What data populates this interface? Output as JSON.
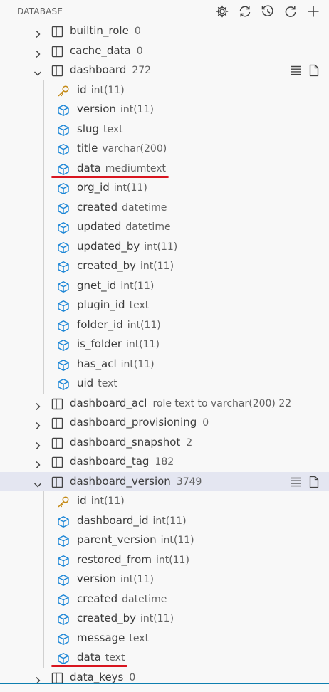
{
  "header": {
    "title": "DATABASE"
  },
  "tables_before": [
    {
      "name": "builtin_role",
      "meta": "0"
    },
    {
      "name": "cache_data",
      "meta": "0"
    }
  ],
  "dashboard": {
    "name": "dashboard",
    "meta": "272",
    "columns": [
      {
        "name": "id",
        "type": "int(11)",
        "key": true
      },
      {
        "name": "version",
        "type": "int(11)"
      },
      {
        "name": "slug",
        "type": "text"
      },
      {
        "name": "title",
        "type": "varchar(200)"
      },
      {
        "name": "data",
        "type": "mediumtext"
      },
      {
        "name": "org_id",
        "type": "int(11)"
      },
      {
        "name": "created",
        "type": "datetime"
      },
      {
        "name": "updated",
        "type": "datetime"
      },
      {
        "name": "updated_by",
        "type": "int(11)"
      },
      {
        "name": "created_by",
        "type": "int(11)"
      },
      {
        "name": "gnet_id",
        "type": "int(11)"
      },
      {
        "name": "plugin_id",
        "type": "text"
      },
      {
        "name": "folder_id",
        "type": "int(11)"
      },
      {
        "name": "is_folder",
        "type": "int(11)"
      },
      {
        "name": "has_acl",
        "type": "int(11)"
      },
      {
        "name": "uid",
        "type": "text"
      }
    ]
  },
  "tables_middle": [
    {
      "name": "dashboard_acl",
      "meta": "role text to varchar(200) 22"
    },
    {
      "name": "dashboard_provisioning",
      "meta": "0"
    },
    {
      "name": "dashboard_snapshot",
      "meta": "2"
    },
    {
      "name": "dashboard_tag",
      "meta": "182"
    }
  ],
  "dashboard_version": {
    "name": "dashboard_version",
    "meta": "3749",
    "columns": [
      {
        "name": "id",
        "type": "int(11)",
        "key": true
      },
      {
        "name": "dashboard_id",
        "type": "int(11)"
      },
      {
        "name": "parent_version",
        "type": "int(11)"
      },
      {
        "name": "restored_from",
        "type": "int(11)"
      },
      {
        "name": "version",
        "type": "int(11)"
      },
      {
        "name": "created",
        "type": "datetime"
      },
      {
        "name": "created_by",
        "type": "int(11)"
      },
      {
        "name": "message",
        "type": "text"
      },
      {
        "name": "data",
        "type": "text"
      }
    ]
  },
  "tables_after": [
    {
      "name": "data_keys",
      "meta": "0"
    }
  ],
  "icons": {
    "header_actions": [
      "settings-icon",
      "refresh-icon",
      "history-icon",
      "reload-icon",
      "add-icon"
    ],
    "row_actions": [
      "list-icon",
      "new-file-icon"
    ]
  },
  "colors": {
    "column_icon": "#1a85d6",
    "key_icon": "#c48a16",
    "highlight": "#d8151f",
    "selected": "#e4e6f1"
  }
}
